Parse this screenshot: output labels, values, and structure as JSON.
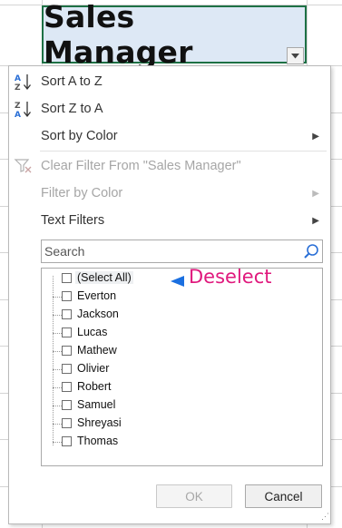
{
  "header": {
    "title": "Sales Manager"
  },
  "menu": {
    "sort_az": "Sort A to Z",
    "sort_za": "Sort Z to A",
    "sort_by_color": "Sort by Color",
    "clear_filter": "Clear Filter From \"Sales Manager\"",
    "filter_by_color": "Filter by Color",
    "text_filters": "Text Filters",
    "submenu_arrow": "▶"
  },
  "search": {
    "placeholder": "Search"
  },
  "list": {
    "items": [
      "(Select All)",
      "Everton",
      "Jackson",
      "Lucas",
      "Mathew",
      "Olivier",
      "Robert",
      "Samuel",
      "Shreyasi",
      "Thomas"
    ]
  },
  "annotation": {
    "text": "Deselect",
    "color": "#e0197d",
    "arrow_color": "#1a6fe0"
  },
  "buttons": {
    "ok": "OK",
    "cancel": "Cancel"
  },
  "icons": {
    "sort_az": "sort-ascending-icon",
    "sort_za": "sort-descending-icon",
    "clear_filter": "clear-filter-icon",
    "search": "search-icon",
    "dropdown": "dropdown-arrow-icon"
  }
}
